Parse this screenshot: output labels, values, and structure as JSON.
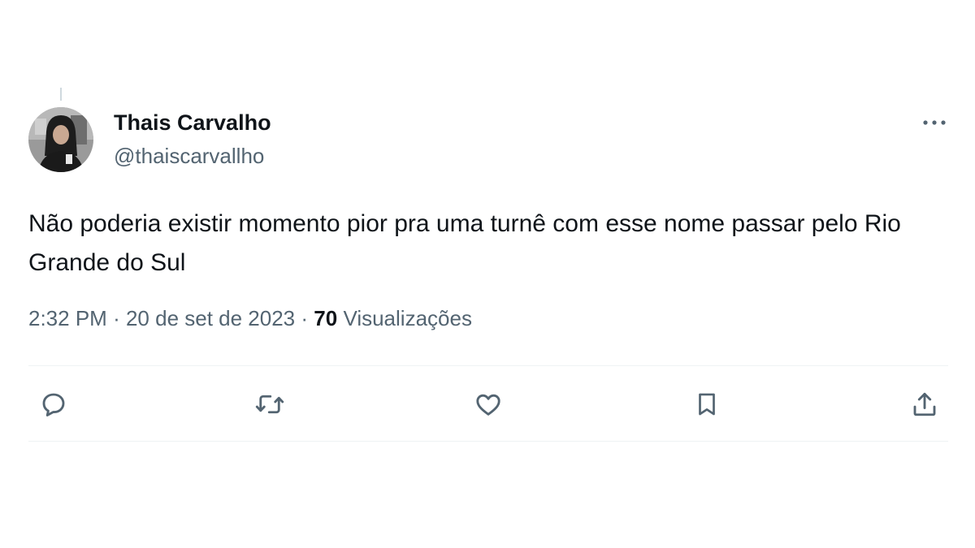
{
  "tweet": {
    "author": {
      "display_name": "Thais Carvalho",
      "handle": "@thaiscarvallho"
    },
    "text": "Não poderia existir momento pior pra uma turnê com esse nome passar pelo Rio Grande do Sul",
    "meta": {
      "time": "2:32 PM",
      "separator": "·",
      "date": "20 de set de 2023",
      "views_count": "70",
      "views_label": "Visualizações"
    }
  },
  "icons": {
    "more": "more-horizontal-icon",
    "reply": "reply-icon",
    "retweet": "retweet-icon",
    "like": "heart-icon",
    "bookmark": "bookmark-icon",
    "share": "share-icon"
  },
  "colors": {
    "text_primary": "#0f1419",
    "text_secondary": "#536471",
    "divider": "#eff3f4"
  }
}
